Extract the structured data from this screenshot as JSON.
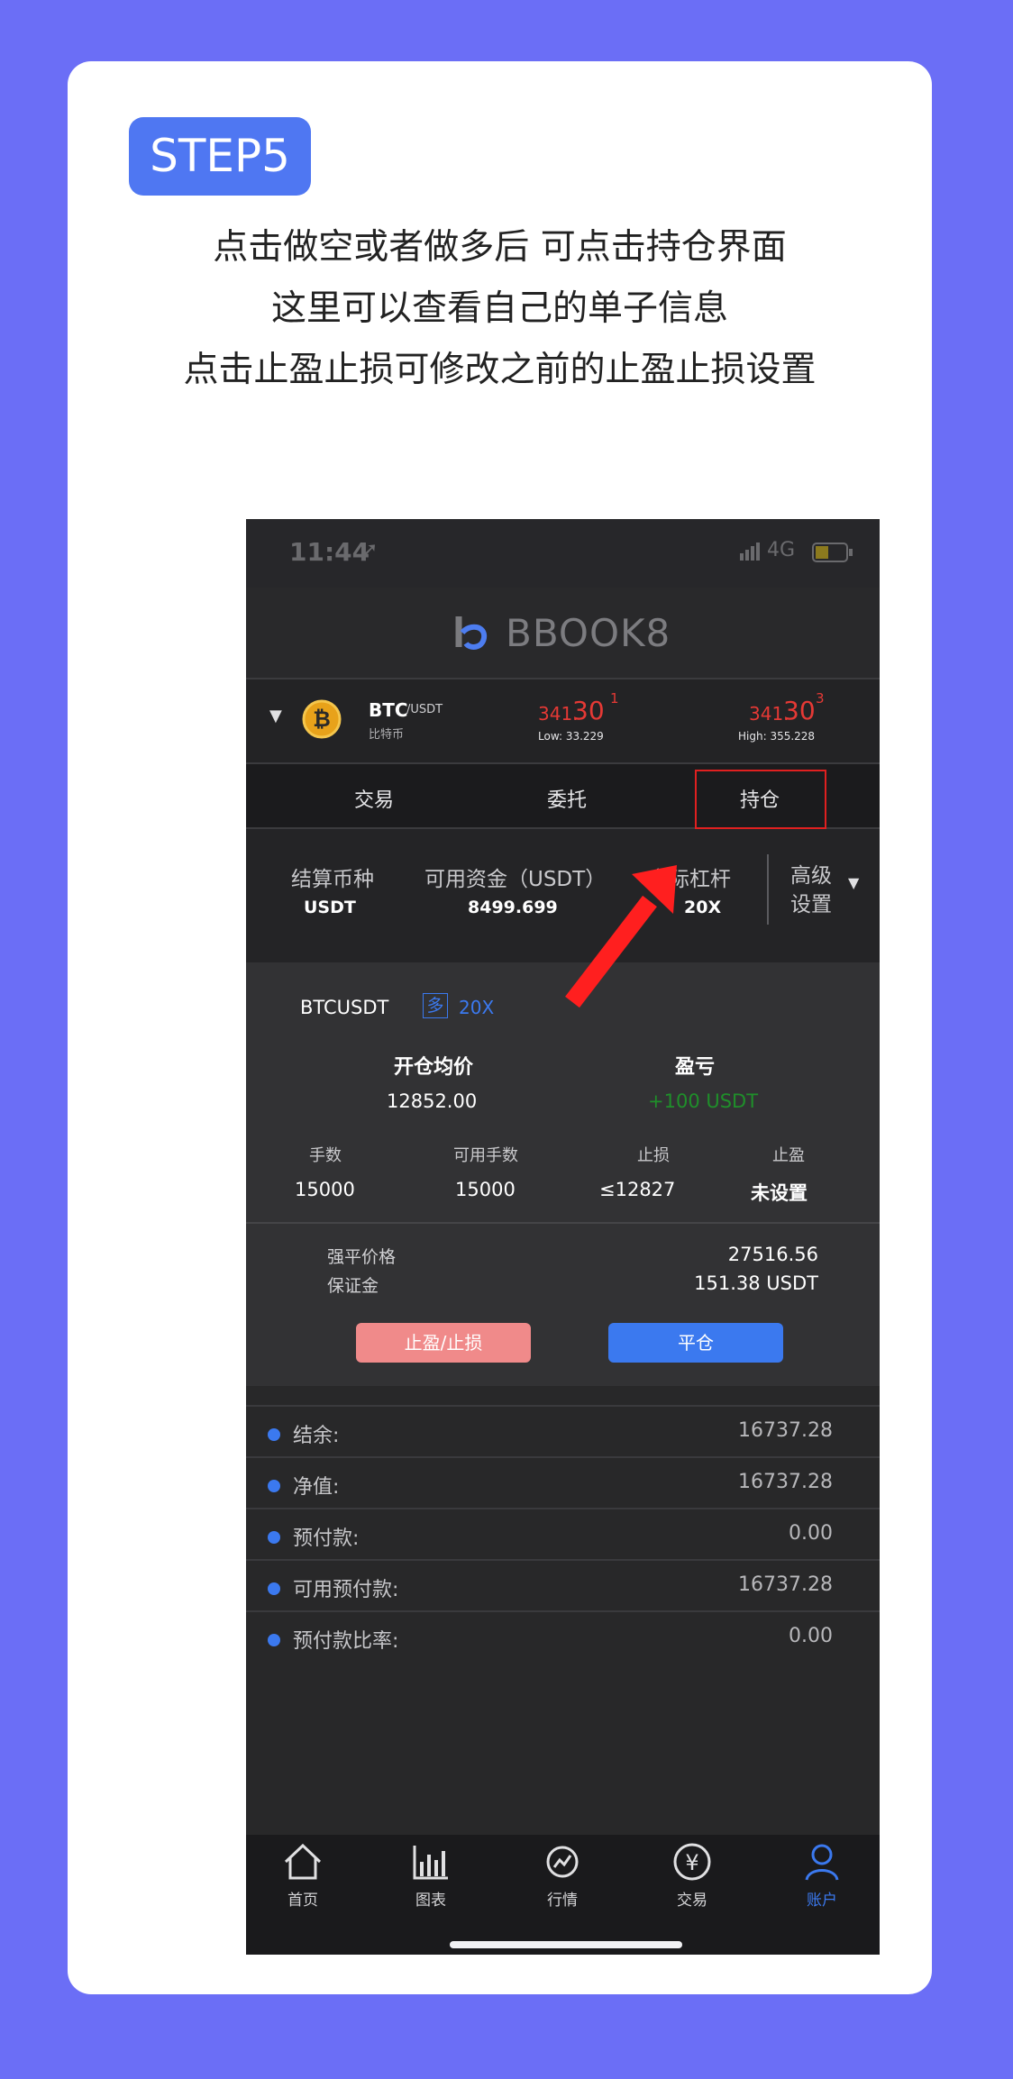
{
  "badge": "STEP5",
  "instructions": [
    "点击做空或者做多后 可点击持仓界面",
    "这里可以查看自己的单子信息",
    "点击止盈止损可修改之前的止盈止损设置"
  ],
  "status": {
    "time": "11:44",
    "network": "4G"
  },
  "brand": "BBOOK8",
  "ticker": {
    "symbol": "BTC",
    "quote": "/USDT",
    "name_cn": "比特币",
    "price1_main": "341.",
    "price1_big": "30",
    "price1_sup": "1",
    "low": "Low: 33.229",
    "price2_main": "341.",
    "price2_big": "30",
    "price2_sup": "3",
    "high": "High: 355.228"
  },
  "tabs": [
    "交易",
    "委托",
    "持仓"
  ],
  "summary": {
    "settle_label": "结算币种",
    "settle_value": "USDT",
    "funds_label": "可用资金（USDT）",
    "funds_value": "8499.699",
    "leverage_label": "实际杠杆",
    "leverage_value": "20X",
    "advanced_label_1": "高级",
    "advanced_label_2": "设置"
  },
  "position": {
    "symbol": "BTCUSDT",
    "side": "多",
    "leverage": "20X",
    "open_price_label": "开仓均价",
    "open_price": "12852.00",
    "pnl_label": "盈亏",
    "pnl": "+100 USDT",
    "lots_label": "手数",
    "lots": "15000",
    "avail_lots_label": "可用手数",
    "avail_lots": "15000",
    "sl_label": "止损",
    "sl": "≤12827",
    "tp_label": "止盈",
    "tp": "未设置",
    "liq_label": "强平价格",
    "liq": "27516.56",
    "margin_label": "保证金",
    "margin": "151.38 USDT",
    "tp_sl_button": "止盈/止损",
    "close_button": "平仓"
  },
  "account": [
    {
      "label": "结余:",
      "value": "16737.28"
    },
    {
      "label": "净值:",
      "value": "16737.28"
    },
    {
      "label": "预付款:",
      "value": "0.00"
    },
    {
      "label": "可用预付款:",
      "value": "16737.28"
    },
    {
      "label": "预付款比率:",
      "value": "0.00"
    }
  ],
  "nav": [
    {
      "label": "首页",
      "icon": "home-icon"
    },
    {
      "label": "图表",
      "icon": "chart-icon"
    },
    {
      "label": "行情",
      "icon": "market-icon"
    },
    {
      "label": "交易",
      "icon": "yen-trade-icon"
    },
    {
      "label": "账户",
      "icon": "user-icon"
    }
  ],
  "colors": {
    "background": "#6b6ef6",
    "badge": "#4f77f2",
    "price_red": "#e53935",
    "profit_green": "#1f8f2a",
    "button_pink": "#f08a8a",
    "button_blue": "#3b79ef",
    "active_nav": "#3b79ef",
    "highlight_box": "#e02020",
    "arrow": "#ff1f1f"
  }
}
